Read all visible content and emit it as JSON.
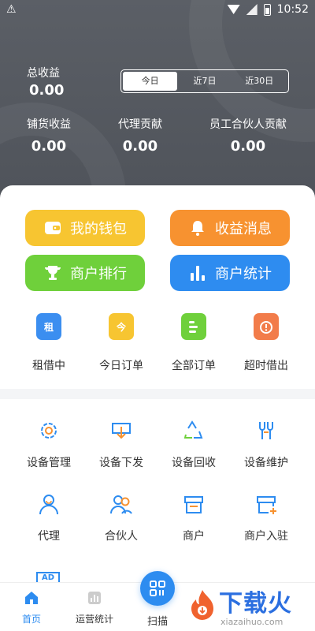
{
  "status_bar": {
    "time": "10:52",
    "warning": "⚠"
  },
  "header": {
    "total_label": "总收益",
    "total_value": "0.00",
    "segments": [
      "今日",
      "近7日",
      "近30日"
    ],
    "active_segment": 0,
    "metrics": [
      {
        "label": "铺货收益",
        "value": "0.00"
      },
      {
        "label": "代理贡献",
        "value": "0.00"
      },
      {
        "label": "员工合伙人贡献",
        "value": "0.00"
      }
    ]
  },
  "action_buttons": [
    {
      "label": "我的钱包",
      "color": "#f7c531",
      "icon": "wallet-icon"
    },
    {
      "label": "收益消息",
      "color": "#f79230",
      "icon": "bell-icon"
    },
    {
      "label": "商户排行",
      "color": "#6fd03b",
      "icon": "trophy-icon"
    },
    {
      "label": "商户统计",
      "color": "#2e8cf0",
      "icon": "bar-chart-icon"
    }
  ],
  "quick_items": [
    {
      "label": "租借中",
      "glyph": "租",
      "color": "#3b8ef0",
      "icon": "renting-icon"
    },
    {
      "label": "今日订单",
      "glyph": "今",
      "color": "#f7c531",
      "icon": "calendar-icon"
    },
    {
      "label": "全部订单",
      "glyph": "",
      "color": "#6fd03b",
      "icon": "list-icon"
    },
    {
      "label": "超时借出",
      "glyph": "",
      "color": "#f27c4a",
      "icon": "alarm-icon"
    }
  ],
  "tools": [
    {
      "label": "设备管理",
      "icon": "gear-icon"
    },
    {
      "label": "设备下发",
      "icon": "download-tray-icon"
    },
    {
      "label": "设备回收",
      "icon": "recycle-icon"
    },
    {
      "label": "设备维护",
      "icon": "wrench-icon"
    },
    {
      "label": "代理",
      "icon": "person-icon"
    },
    {
      "label": "合伙人",
      "icon": "partners-icon"
    },
    {
      "label": "商户",
      "icon": "store-icon"
    },
    {
      "label": "商户入驻",
      "icon": "store-add-icon"
    }
  ],
  "ad_label": "AD",
  "tabs": [
    {
      "label": "首页",
      "active": true,
      "icon": "home-icon"
    },
    {
      "label": "运营统计",
      "active": false,
      "icon": "stats-icon"
    },
    {
      "label": "扫描",
      "active": false,
      "icon": "scan-icon"
    }
  ],
  "watermark": {
    "title": "下载火",
    "subtitle": "xiazaihuo.com"
  },
  "colors": {
    "accent": "#2d8cf0",
    "header_bg": "#54585f",
    "icon_blue": "#2d8cf0"
  }
}
